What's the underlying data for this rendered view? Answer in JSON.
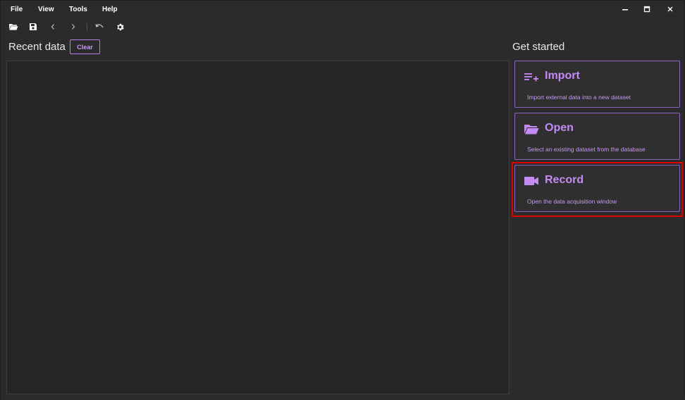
{
  "menubar": {
    "file": "File",
    "view": "View",
    "tools": "Tools",
    "help": "Help"
  },
  "window_controls": {
    "minimize_icon": "minimize-icon",
    "maximize_icon": "maximize-icon",
    "close_icon": "close-icon"
  },
  "toolbar": {
    "icons": [
      "folder-open-icon",
      "save-icon",
      "chevron-left-icon",
      "chevron-right-icon",
      "undo-icon",
      "gear-icon"
    ]
  },
  "recent": {
    "title": "Recent data",
    "clear_label": "Clear"
  },
  "get_started": {
    "title": "Get started",
    "cards": [
      {
        "title": "Import",
        "description": "Import external data into a new dataset",
        "icon": "playlist-add-icon"
      },
      {
        "title": "Open",
        "description": "Select an existing dataset from the database",
        "icon": "folder-open-icon"
      },
      {
        "title": "Record",
        "description": "Open the data acquisition window",
        "icon": "video-camera-icon"
      }
    ]
  },
  "colors": {
    "background": "#2b2b2b",
    "accent": "#c48cf3",
    "highlight": "#e00000"
  }
}
